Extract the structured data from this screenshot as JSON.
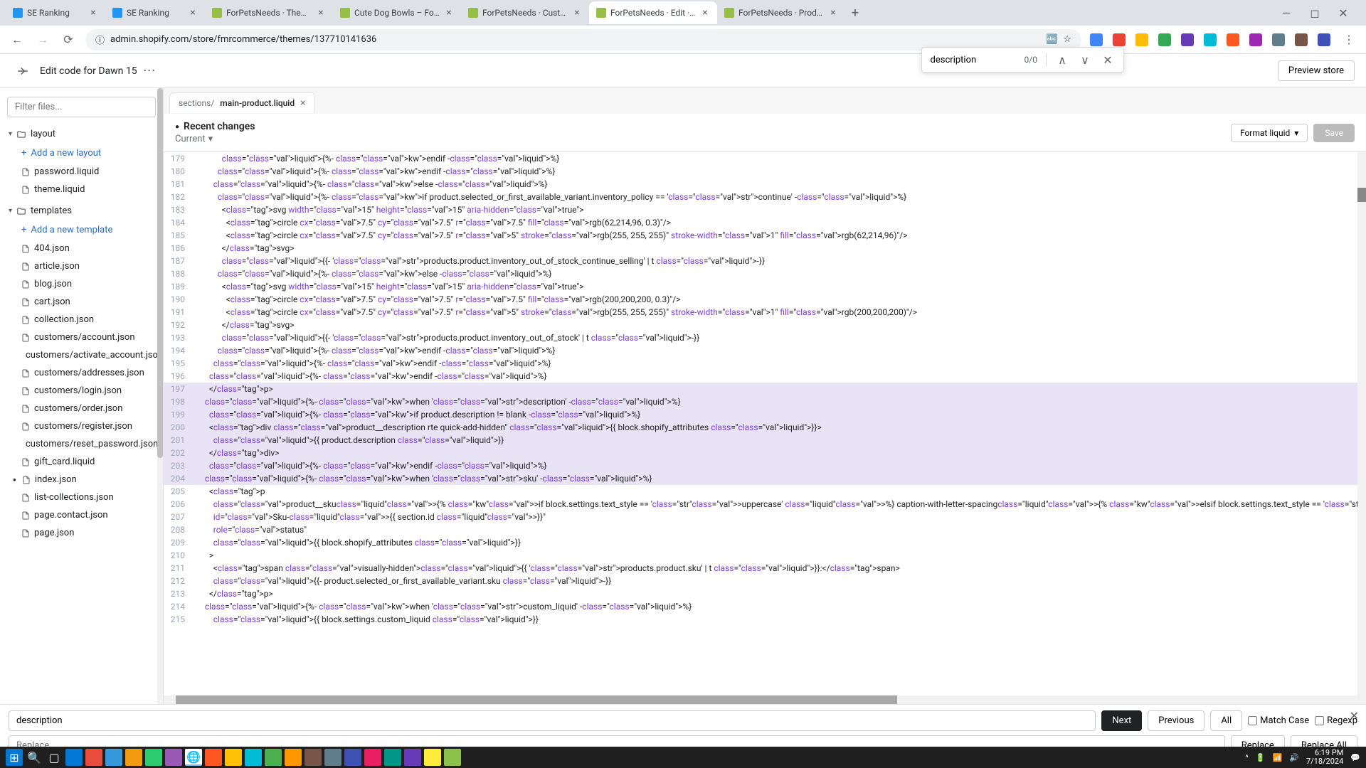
{
  "browser": {
    "tabs": [
      {
        "title": "SE Ranking",
        "favicon": "#2196f3"
      },
      {
        "title": "SE Ranking",
        "favicon": "#2196f3"
      },
      {
        "title": "ForPetsNeeds · Themes · Shop",
        "favicon": "#95bf47"
      },
      {
        "title": "Cute Dog Bowls – ForPetsNee",
        "favicon": "#95bf47"
      },
      {
        "title": "ForPetsNeeds · Customize Daw",
        "favicon": "#95bf47"
      },
      {
        "title": "ForPetsNeeds · Edit · Dawn 15",
        "favicon": "#95bf47",
        "active": true
      },
      {
        "title": "ForPetsNeeds · Products · Cute",
        "favicon": "#95bf47"
      }
    ],
    "url": "admin.shopify.com/store/fmrcommerce/themes/137710141636"
  },
  "find": {
    "query": "description",
    "count": "0/0"
  },
  "header": {
    "title": "Edit code for Dawn 15",
    "preview": "Preview store"
  },
  "sidebar": {
    "filter_placeholder": "Filter files...",
    "layout": {
      "label": "layout",
      "add": "Add a new layout",
      "files": [
        "password.liquid",
        "theme.liquid"
      ]
    },
    "templates": {
      "label": "templates",
      "add": "Add a new template",
      "files": [
        "404.json",
        "article.json",
        "blog.json",
        "cart.json",
        "collection.json",
        "customers/account.json",
        "customers/activate_account.json",
        "customers/addresses.json",
        "customers/login.json",
        "customers/order.json",
        "customers/register.json",
        "customers/reset_password.json",
        "gift_card.liquid",
        "index.json",
        "list-collections.json",
        "page.contact.json",
        "page.json"
      ]
    },
    "modified_file": "index.json"
  },
  "editor": {
    "tab_path": "sections/",
    "tab_name": "main-product.liquid",
    "recent_changes": "Recent changes",
    "current": "Current",
    "format": "Format liquid",
    "save": "Save",
    "lines": [
      {
        "n": 179,
        "t": "              {%- endif -%}"
      },
      {
        "n": 180,
        "t": "            {%- endif -%}"
      },
      {
        "n": 181,
        "t": "          {%- else -%}"
      },
      {
        "n": 182,
        "t": "            {%- if product.selected_or_first_available_variant.inventory_policy == 'continue' -%}"
      },
      {
        "n": 183,
        "t": "              <svg width=\"15\" height=\"15\" aria-hidden=\"true\">"
      },
      {
        "n": 184,
        "t": "                <circle cx=\"7.5\" cy=\"7.5\" r=\"7.5\" fill=\"rgb(62,214,96, 0.3)\"/>"
      },
      {
        "n": 185,
        "t": "                <circle cx=\"7.5\" cy=\"7.5\" r=\"5\" stroke=\"rgb(255, 255, 255)\" stroke-width=\"1\" fill=\"rgb(62,214,96)\"/>"
      },
      {
        "n": 186,
        "t": "              </svg>"
      },
      {
        "n": 187,
        "t": "              {{- 'products.product.inventory_out_of_stock_continue_selling' | t -}}"
      },
      {
        "n": 188,
        "t": "            {%- else -%}"
      },
      {
        "n": 189,
        "t": "              <svg width=\"15\" height=\"15\" aria-hidden=\"true\">"
      },
      {
        "n": 190,
        "t": "                <circle cx=\"7.5\" cy=\"7.5\" r=\"7.5\" fill=\"rgb(200,200,200, 0.3)\"/>"
      },
      {
        "n": 191,
        "t": "                <circle cx=\"7.5\" cy=\"7.5\" r=\"5\" stroke=\"rgb(255, 255, 255)\" stroke-width=\"1\" fill=\"rgb(200,200,200)\"/>"
      },
      {
        "n": 192,
        "t": "              </svg>"
      },
      {
        "n": 193,
        "t": "              {{- 'products.product.inventory_out_of_stock' | t -}}"
      },
      {
        "n": 194,
        "t": "            {%- endif -%}"
      },
      {
        "n": 195,
        "t": "          {%- endif -%}"
      },
      {
        "n": 196,
        "t": "        {%- endif -%}"
      },
      {
        "n": 197,
        "t": "        </p>",
        "hl": true
      },
      {
        "n": 198,
        "t": "      {%- when 'description' -%}",
        "hl": true
      },
      {
        "n": 199,
        "t": "        {%- if product.description != blank -%}",
        "hl": true
      },
      {
        "n": 200,
        "t": "        <div class=\"product__description rte quick-add-hidden\" {{ block.shopify_attributes }}>",
        "hl": true
      },
      {
        "n": 201,
        "t": "          {{ product.description }}",
        "hl": true
      },
      {
        "n": 202,
        "t": "        </div>",
        "hl": true
      },
      {
        "n": 203,
        "t": "        {%- endif -%}",
        "hl": true
      },
      {
        "n": 204,
        "t": "      {%- when 'sku' -%}",
        "hl": true
      },
      {
        "n": 205,
        "t": "        <p"
      },
      {
        "n": 206,
        "t": "          class=\"product__sku{% if block.settings.text_style == 'uppercase' %} caption-with-letter-spacing{% elsif block.settings.text_style == 'subtitle' %} subtitle{% endif %}{% if product.selected_or_f"
      },
      {
        "n": 207,
        "t": "          id=\"Sku-{{ section.id }}\""
      },
      {
        "n": 208,
        "t": "          role=\"status\""
      },
      {
        "n": 209,
        "t": "          {{ block.shopify_attributes }}"
      },
      {
        "n": 210,
        "t": "        >"
      },
      {
        "n": 211,
        "t": "          <span class=\"visually-hidden\">{{ 'products.product.sku' | t }}:</span>"
      },
      {
        "n": 212,
        "t": "          {{- product.selected_or_first_available_variant.sku -}}"
      },
      {
        "n": 213,
        "t": "        </p>"
      },
      {
        "n": 214,
        "t": "      {%- when 'custom_liquid' -%}"
      },
      {
        "n": 215,
        "t": "          {{ block.settings.custom_liquid }}"
      }
    ]
  },
  "search": {
    "find_value": "description",
    "replace_placeholder": "Replace",
    "next": "Next",
    "previous": "Previous",
    "all": "All",
    "match_case": "Match Case",
    "regexp": "Regexp",
    "replace": "Replace",
    "replace_all": "Replace All"
  },
  "taskbar": {
    "time": "6:19 PM",
    "date": "7/18/2024"
  }
}
